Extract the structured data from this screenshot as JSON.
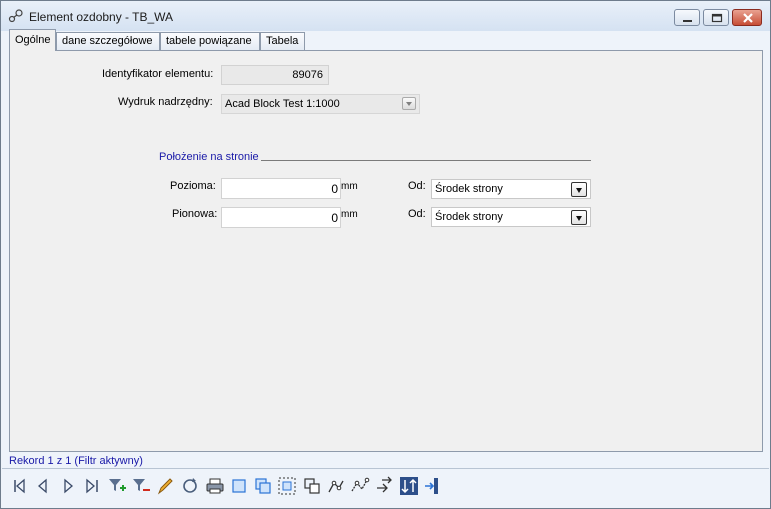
{
  "window": {
    "title": "Element ozdobny - TB_WA",
    "app_icon": "link-nodes-icon",
    "controls": [
      "minimize-icon",
      "maximize-icon",
      "close-icon"
    ]
  },
  "tabs": [
    {
      "label": "Ogólne",
      "active": true
    },
    {
      "label": "dane szczegółowe",
      "active": false
    },
    {
      "label": "tabele powiązane",
      "active": false
    },
    {
      "label": "Tabela",
      "active": false
    }
  ],
  "general": {
    "identifier_label": "Identyfikator elementu:",
    "identifier_value": "89076",
    "parent_print_label": "Wydruk nadrzędny:",
    "parent_print_value": "Acad Block Test 1:1000"
  },
  "position": {
    "section_title": "Położenie na stronie",
    "horizontal_label": "Pozioma:",
    "horizontal_value": "0",
    "horizontal_unit": "mm",
    "horizontal_from_label": "Od:",
    "horizontal_from_value": "Środek strony",
    "vertical_label": "Pionowa:",
    "vertical_value": "0",
    "vertical_unit": "mm",
    "vertical_from_label": "Od:",
    "vertical_from_value": "Środek strony"
  },
  "status": {
    "record_text": "Rekord 1 z 1 (Filtr aktywny)"
  },
  "toolbar": [
    "first-record-icon",
    "previous-record-icon",
    "next-record-icon",
    "last-record-icon",
    "filter-add-icon",
    "filter-remove-icon",
    "edit-pencil-icon",
    "refresh-icon",
    "print-icon",
    "select-one-icon",
    "select-many-icon",
    "select-frame-icon",
    "zoom-to-icon",
    "move-to-icon",
    "transform-icon",
    "shift-icon",
    "attribute-transfer-icon",
    "exit-icon"
  ],
  "colors": {
    "accent_blue": "#1a1aa8",
    "panel_bg": "#f0f0f0",
    "close_button": "#c74e36"
  }
}
